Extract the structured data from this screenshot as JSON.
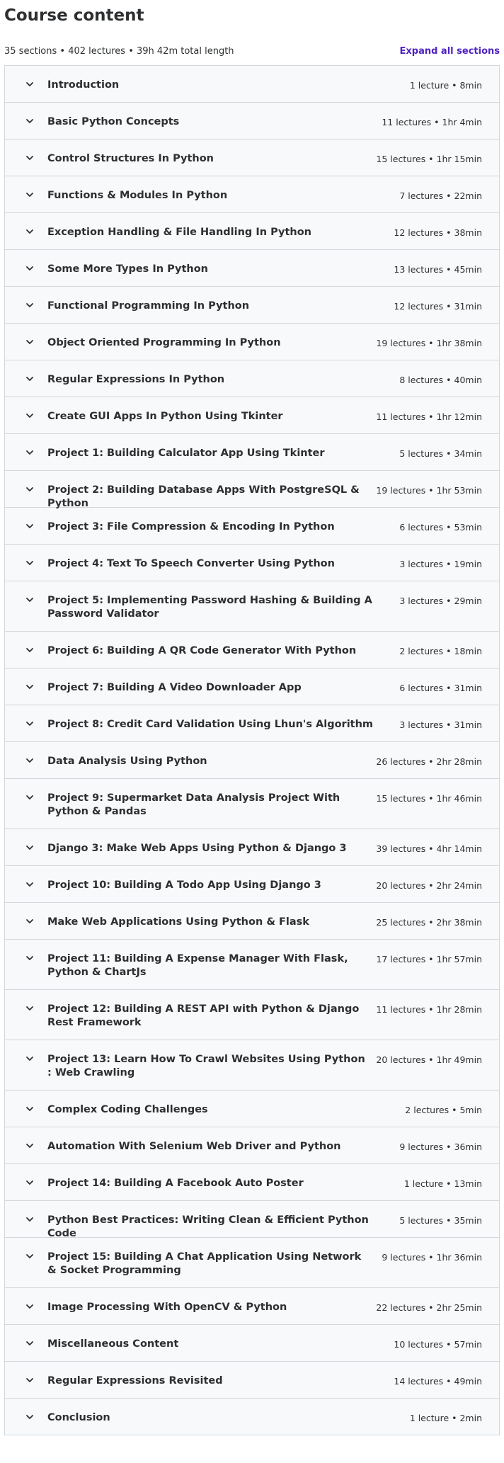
{
  "heading": "Course content",
  "summary": "35 sections • 402 lectures • 39h 42m total length",
  "expand_label": "Expand all sections",
  "sections": [
    {
      "title": "Introduction",
      "stats": "1 lecture • 8min"
    },
    {
      "title": "Basic Python Concepts",
      "stats": "11 lectures • 1hr 4min"
    },
    {
      "title": "Control Structures In Python",
      "stats": "15 lectures • 1hr 15min"
    },
    {
      "title": "Functions & Modules In Python",
      "stats": "7 lectures • 22min"
    },
    {
      "title": "Exception Handling & File Handling In Python",
      "stats": "12 lectures • 38min"
    },
    {
      "title": "Some More Types In Python",
      "stats": "13 lectures • 45min"
    },
    {
      "title": "Functional Programming In Python",
      "stats": "12 lectures • 31min"
    },
    {
      "title": "Object Oriented Programming In Python",
      "stats": "19 lectures • 1hr 38min"
    },
    {
      "title": "Regular Expressions In Python",
      "stats": "8 lectures • 40min"
    },
    {
      "title": "Create GUI Apps In Python Using Tkinter",
      "stats": "11 lectures • 1hr 12min"
    },
    {
      "title": "Project 1: Building Calculator App Using Tkinter",
      "stats": "5 lectures • 34min"
    },
    {
      "title": "Project 2: Building Database Apps With PostgreSQL & Python",
      "stats": "19 lectures • 1hr 53min"
    },
    {
      "title": "Project 3: File Compression & Encoding In Python",
      "stats": "6 lectures • 53min"
    },
    {
      "title": "Project 4: Text To Speech Converter Using Python",
      "stats": "3 lectures • 19min"
    },
    {
      "title": "Project 5: Implementing Password Hashing & Building A Password Validator",
      "stats": "3 lectures • 29min",
      "tall": true
    },
    {
      "title": "Project 6: Building A QR Code Generator With Python",
      "stats": "2 lectures • 18min"
    },
    {
      "title": "Project 7: Building A Video Downloader App",
      "stats": "6 lectures • 31min"
    },
    {
      "title": "Project 8: Credit Card Validation Using Lhun's Algorithm",
      "stats": "3 lectures • 31min"
    },
    {
      "title": "Data Analysis Using Python",
      "stats": "26 lectures • 2hr 28min"
    },
    {
      "title": "Project 9: Supermarket Data Analysis Project With Python & Pandas",
      "stats": "15 lectures • 1hr 46min",
      "tall": true
    },
    {
      "title": "Django 3: Make Web Apps Using Python & Django 3",
      "stats": "39 lectures • 4hr 14min"
    },
    {
      "title": "Project 10: Building A Todo App Using Django 3",
      "stats": "20 lectures • 2hr 24min"
    },
    {
      "title": "Make Web Applications Using Python & Flask",
      "stats": "25 lectures • 2hr 38min"
    },
    {
      "title": "Project 11: Building A Expense Manager With Flask, Python & ChartJs",
      "stats": "17 lectures • 1hr 57min",
      "tall": true
    },
    {
      "title": "Project 12: Building A REST API with Python & Django Rest Framework",
      "stats": "11 lectures • 1hr 28min",
      "tall": true
    },
    {
      "title": "Project 13: Learn How To Crawl Websites Using Python : Web Crawling",
      "stats": "20 lectures • 1hr 49min",
      "tall": true
    },
    {
      "title": "Complex Coding Challenges",
      "stats": "2 lectures • 5min"
    },
    {
      "title": "Automation With Selenium Web Driver and Python",
      "stats": "9 lectures • 36min"
    },
    {
      "title": "Project 14: Building A Facebook Auto Poster",
      "stats": "1 lecture • 13min"
    },
    {
      "title": "Python Best Practices: Writing Clean & Efficient Python Code",
      "stats": "5 lectures • 35min"
    },
    {
      "title": "Project 15: Building A Chat Application Using Network & Socket Programming",
      "stats": "9 lectures • 1hr 36min",
      "tall": true
    },
    {
      "title": "Image Processing With OpenCV & Python",
      "stats": "22 lectures • 2hr 25min"
    },
    {
      "title": "Miscellaneous Content",
      "stats": "10 lectures • 57min"
    },
    {
      "title": "Regular Expressions Revisited",
      "stats": "14 lectures • 49min"
    },
    {
      "title": "Conclusion",
      "stats": "1 lecture • 2min"
    }
  ]
}
